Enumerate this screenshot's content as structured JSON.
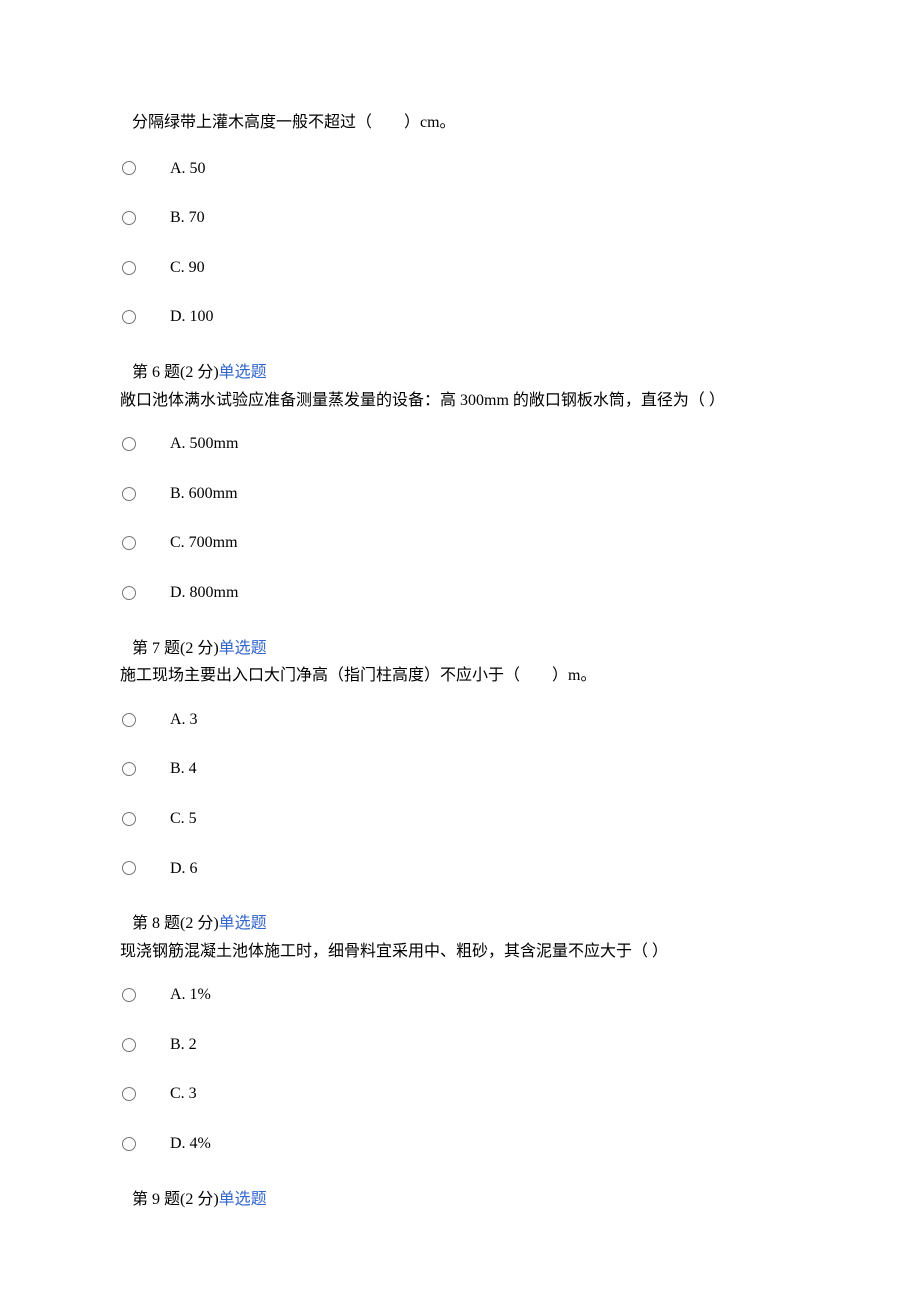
{
  "q5": {
    "stem": "分隔绿带上灌木高度一般不超过（　　）cm。",
    "options": [
      {
        "label": "A.  50"
      },
      {
        "label": "B.  70"
      },
      {
        "label": "C. 90"
      },
      {
        "label": "D. 100"
      }
    ]
  },
  "q6": {
    "header_prefix": "  第 6 题(2 分)",
    "type_label": "单选题",
    "stem": "敞口池体满水试验应准备测量蒸发量的设备：高 300mm 的敞口钢板水筒，直径为（ ）",
    "options": [
      {
        "label": "A. 500mm"
      },
      {
        "label": "B. 600mm"
      },
      {
        "label": "C. 700mm"
      },
      {
        "label": "D. 800mm"
      }
    ]
  },
  "q7": {
    "header_prefix": "  第 7 题(2 分)",
    "type_label": "单选题",
    "stem": "  施工现场主要出入口大门净高（指门柱高度）不应小于（　　）m。",
    "options": [
      {
        "label": "A. 3"
      },
      {
        "label": "B. 4"
      },
      {
        "label": "C. 5"
      },
      {
        "label": "D. 6"
      }
    ]
  },
  "q8": {
    "header_prefix": "  第 8 题(2 分)",
    "type_label": "单选题",
    "stem": "现浇钢筋混凝土池体施工时，细骨料宜采用中、粗砂，其含泥量不应大于（ ）",
    "options": [
      {
        "label": "A. 1%"
      },
      {
        "label": "B. 2"
      },
      {
        "label": "C. 3"
      },
      {
        "label": "D. 4%"
      }
    ]
  },
  "q9": {
    "header_prefix": "  第 9 题(2 分)",
    "type_label": "单选题"
  }
}
